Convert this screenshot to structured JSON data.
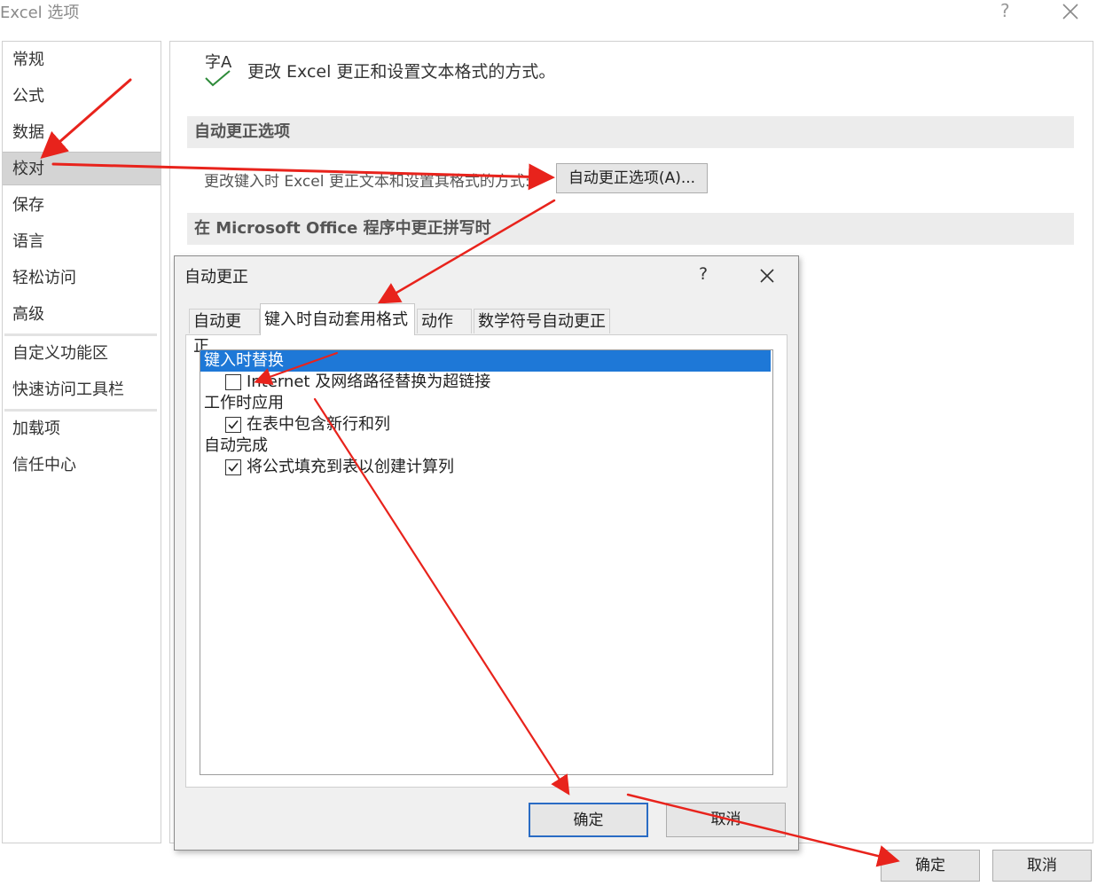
{
  "window": {
    "title": "Excel 选项",
    "help": "?"
  },
  "sidebar": {
    "items": [
      {
        "label": "常规"
      },
      {
        "label": "公式"
      },
      {
        "label": "数据"
      },
      {
        "label": "校对"
      },
      {
        "label": "保存"
      },
      {
        "label": "语言"
      },
      {
        "label": "轻松访问"
      },
      {
        "label": "高级"
      },
      {
        "label": "自定义功能区"
      },
      {
        "label": "快速访问工具栏"
      },
      {
        "label": "加载项"
      },
      {
        "label": "信任中心"
      }
    ],
    "active": "校对"
  },
  "main": {
    "header_icon_text": "字A",
    "header_text": "更改 Excel 更正和设置文本格式的方式。",
    "section1": "自动更正选项",
    "desc": "更改键入时 Excel 更正文本和设置其格式的方式:",
    "autocorrect_button": "自动更正选项(A)...",
    "section2": "在 Microsoft Office 程序中更正拼写时",
    "ok": "确定",
    "cancel": "取消"
  },
  "dialog": {
    "title": "自动更正",
    "help": "?",
    "tabs": [
      {
        "label": "自动更正"
      },
      {
        "label": "键入时自动套用格式"
      },
      {
        "label": "动作"
      },
      {
        "label": "数学符号自动更正"
      }
    ],
    "active_tab": "键入时自动套用格式",
    "list": {
      "group1": "键入时替换",
      "opt_internet": {
        "label": "Internet 及网络路径替换为超链接",
        "checked": false
      },
      "group2": "工作时应用",
      "opt_rows": {
        "label": "在表中包含新行和列",
        "checked": true
      },
      "group3": "自动完成",
      "opt_formula": {
        "label": "将公式填充到表以创建计算列",
        "checked": true
      }
    },
    "ok": "确定",
    "cancel": "取消"
  },
  "colors": {
    "selection": "#1e78d7",
    "arrow": "#e8231c",
    "check_green": "#2e8b3a"
  }
}
